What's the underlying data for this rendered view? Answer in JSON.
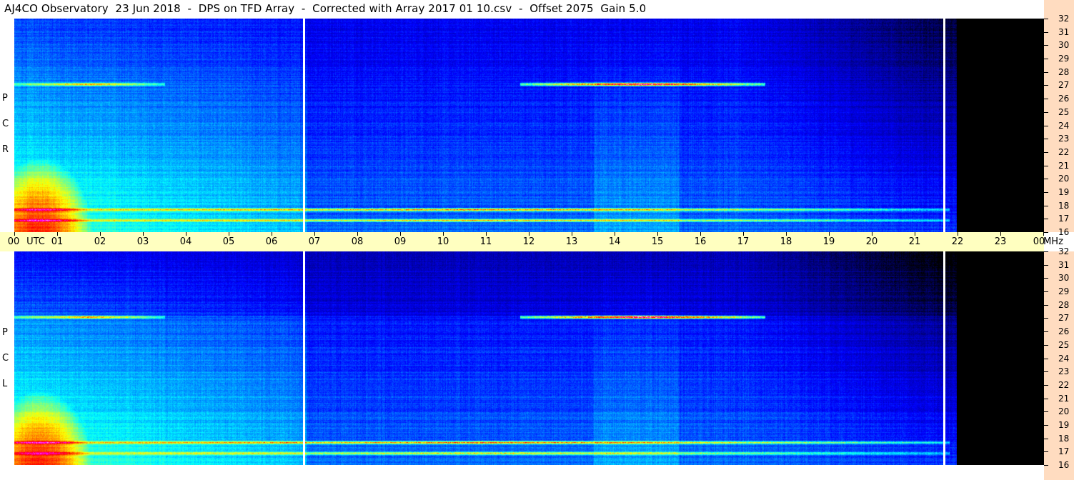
{
  "title": "AJ4CO Observatory  23 Jun 2018  -  DPS on TFD Array  -  Corrected with Array 2017 01 10.csv  -  Offset 2075  Gain 5.0",
  "chart_data": {
    "type": "heatmap",
    "x_axis": {
      "unit_label": "UTC",
      "ticks": [
        "00",
        "01",
        "02",
        "03",
        "04",
        "05",
        "06",
        "07",
        "08",
        "09",
        "10",
        "11",
        "12",
        "13",
        "14",
        "15",
        "16",
        "17",
        "18",
        "19",
        "20",
        "21",
        "22",
        "23",
        "00"
      ],
      "range_hours": [
        0,
        24
      ]
    },
    "y_axis": {
      "unit_label": "MHz",
      "ticks": [
        "32",
        "31",
        "30",
        "29",
        "28",
        "27",
        "26",
        "25",
        "24",
        "23",
        "22",
        "21",
        "20",
        "19",
        "18",
        "17",
        "16"
      ],
      "range_mhz": [
        16,
        32
      ]
    },
    "panels": [
      {
        "name": "RCP",
        "letters": [
          "R",
          "C",
          "P"
        ]
      },
      {
        "name": "LCP",
        "letters": [
          "L",
          "C",
          "P"
        ]
      }
    ],
    "colormap": [
      "#000000",
      "#00008f",
      "#0000ff",
      "#0080ff",
      "#00ffff",
      "#80ff80",
      "#ffff00",
      "#ff8000",
      "#ff0000",
      "#ff00ff",
      "#ffffff"
    ],
    "gap_markers_utc": [
      6.75,
      21.68
    ],
    "no_data_from_utc": 21.98,
    "features": [
      {
        "freq_mhz": 27.1,
        "start_utc": 0.0,
        "end_utc": 3.5,
        "strength": 0.55
      },
      {
        "freq_mhz": 27.1,
        "start_utc": 11.8,
        "end_utc": 17.5,
        "strength": 0.95
      },
      {
        "freq_mhz": 17.7,
        "start_utc": 0.0,
        "end_utc": 21.8,
        "strength": 0.6
      },
      {
        "freq_mhz": 16.9,
        "start_utc": 0.0,
        "end_utc": 21.8,
        "strength": 0.5
      }
    ]
  }
}
